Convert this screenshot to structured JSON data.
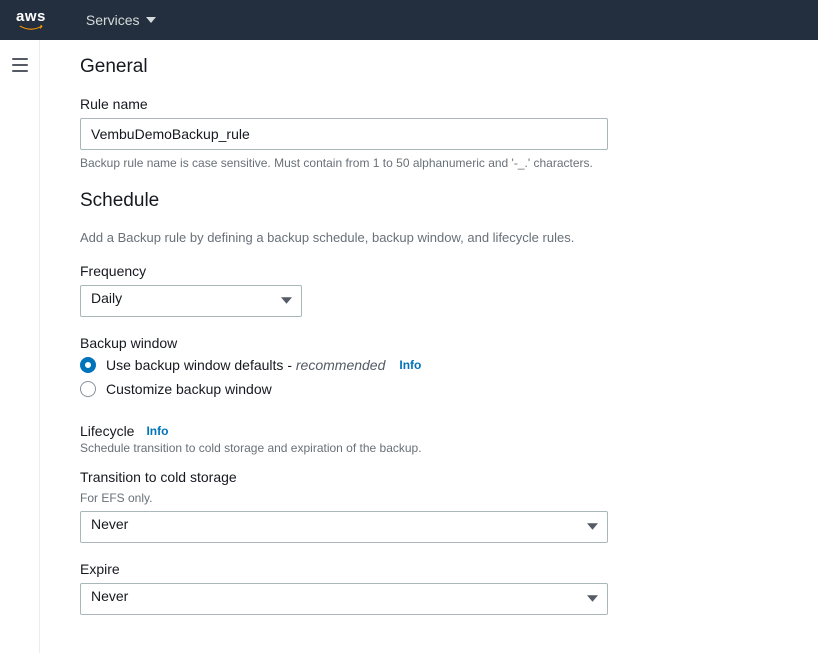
{
  "nav": {
    "services_label": "Services"
  },
  "general": {
    "title": "General",
    "rule_name_label": "Rule name",
    "rule_name_value": "VembuDemoBackup_rule",
    "rule_name_help": "Backup rule name is case sensitive. Must contain from 1 to 50 alphanumeric and '-_.' characters."
  },
  "schedule": {
    "title": "Schedule",
    "desc": "Add a Backup rule by defining a backup schedule, backup window, and lifecycle rules.",
    "frequency_label": "Frequency",
    "frequency_value": "Daily",
    "backup_window_label": "Backup window",
    "radio_default_label": "Use backup window defaults",
    "radio_default_dash": " - ",
    "radio_default_reco": "recommended",
    "radio_custom_label": "Customize backup window",
    "info_label": "Info"
  },
  "lifecycle": {
    "title": "Lifecycle",
    "info_label": "Info",
    "desc": "Schedule transition to cold storage and expiration of the backup.",
    "transition_label": "Transition to cold storage",
    "transition_help": "For EFS only.",
    "transition_value": "Never",
    "expire_label": "Expire",
    "expire_value": "Never"
  }
}
